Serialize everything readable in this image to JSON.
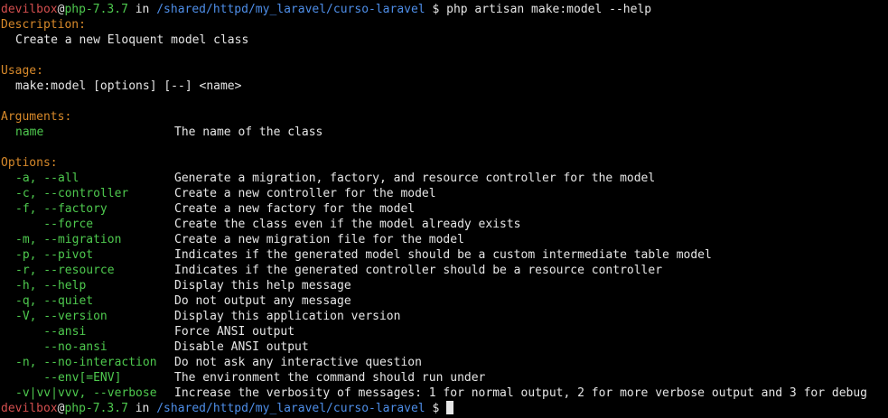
{
  "prompt": {
    "user": "devilbox",
    "at": "@",
    "host": "php-7.3.7",
    "in_word": " in ",
    "path": "/shared/httpd/my_laravel/curso-laravel",
    "symbol": " $ "
  },
  "command": "php artisan make:model --help",
  "description": {
    "heading": "Description:",
    "text": "Create a new Eloquent model class"
  },
  "usage": {
    "heading": "Usage:",
    "text": "make:model [options] [--] <name>"
  },
  "arguments": {
    "heading": "Arguments:",
    "items": [
      {
        "name": "name",
        "desc": "The name of the class"
      }
    ]
  },
  "options": {
    "heading": "Options:",
    "items": [
      {
        "flag": "-a, --all",
        "desc": "Generate a migration, factory, and resource controller for the model"
      },
      {
        "flag": "-c, --controller",
        "desc": "Create a new controller for the model"
      },
      {
        "flag": "-f, --factory",
        "desc": "Create a new factory for the model"
      },
      {
        "flag": "    --force",
        "desc": "Create the class even if the model already exists"
      },
      {
        "flag": "-m, --migration",
        "desc": "Create a new migration file for the model"
      },
      {
        "flag": "-p, --pivot",
        "desc": "Indicates if the generated model should be a custom intermediate table model"
      },
      {
        "flag": "-r, --resource",
        "desc": "Indicates if the generated controller should be a resource controller"
      },
      {
        "flag": "-h, --help",
        "desc": "Display this help message"
      },
      {
        "flag": "-q, --quiet",
        "desc": "Do not output any message"
      },
      {
        "flag": "-V, --version",
        "desc": "Display this application version"
      },
      {
        "flag": "    --ansi",
        "desc": "Force ANSI output"
      },
      {
        "flag": "    --no-ansi",
        "desc": "Disable ANSI output"
      },
      {
        "flag": "-n, --no-interaction",
        "desc": "Do not ask any interactive question"
      },
      {
        "flag": "    --env[=ENV]",
        "desc": "The environment the command should run under"
      },
      {
        "flag": "-v|vv|vvv, --verbose",
        "desc": "Increase the verbosity of messages: 1 for normal output, 2 for more verbose output and 3 for debug"
      }
    ]
  },
  "colors": {
    "background": "#000000",
    "text": "#e6e6e6",
    "user": "#d34e4e",
    "host": "#4ec94e",
    "path": "#4e8ee8",
    "heading": "#d7892a",
    "option": "#4ec94e"
  }
}
